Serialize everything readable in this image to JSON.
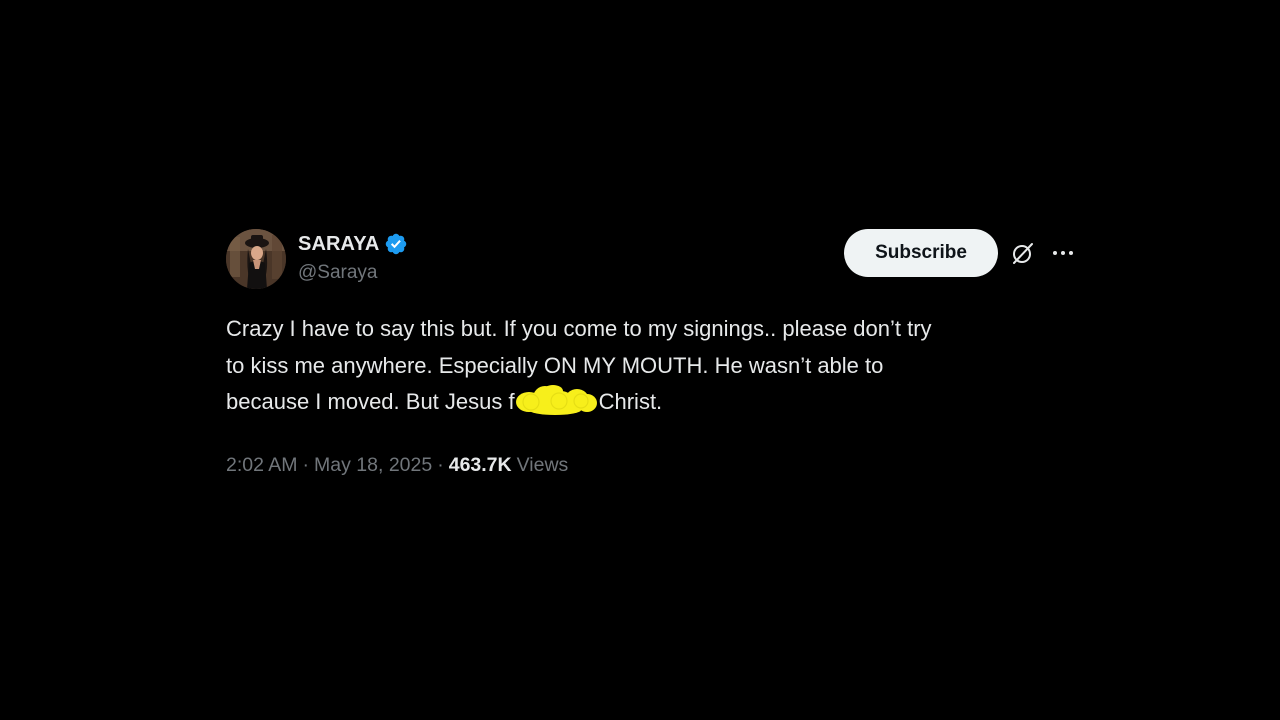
{
  "tweet": {
    "author": {
      "display_name": "SARAYA",
      "handle": "@Saraya",
      "verified_icon": "verified-badge-icon",
      "avatar_icon": "avatar"
    },
    "actions": {
      "subscribe_label": "Subscribe",
      "grok_icon": "grok-icon",
      "more_icon": "more-options-icon"
    },
    "body": {
      "line1": "Crazy I have to say this but. If you come to my signings.. please don’t try",
      "line2": "to kiss me anywhere. Especially ON MY MOUTH. He wasn’t able to",
      "line3_before": "because I moved. But Jesus f",
      "line3_after": "Christ."
    },
    "meta": {
      "time": "2:02 AM",
      "separator": "·",
      "date": "May 18, 2025",
      "views_count": "463.7K",
      "views_label": "Views"
    }
  },
  "colors": {
    "background": "#000000",
    "text_primary": "#e7e9ea",
    "text_secondary": "#71767b",
    "verified_blue": "#1d9bf0",
    "subscribe_bg": "#eff3f4",
    "censor_yellow": "#f7ef1b"
  }
}
